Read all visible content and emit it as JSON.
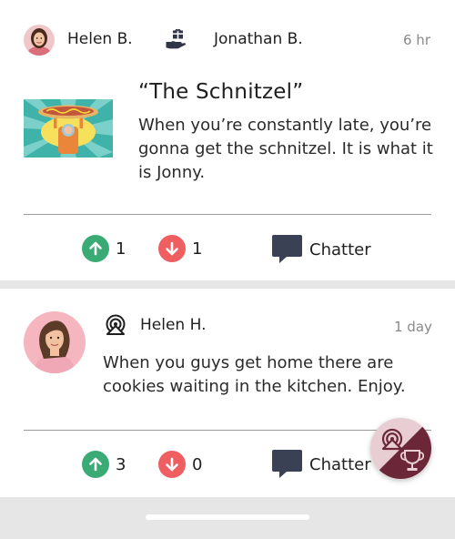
{
  "feed": [
    {
      "from": "Helen B.",
      "to": "Jonathan B.",
      "time": "6 hr",
      "title": "“The Schnitzel”",
      "body_lines": [
        "When you’re constantly late, you’re",
        "gonna get the schnitzel. It is what it",
        "is Jonny."
      ],
      "upvotes": "1",
      "downvotes": "1",
      "chatter_label": "Chatter",
      "action_icon": "gift-hand-icon"
    },
    {
      "author": "Helen H.",
      "time": "1 day",
      "body_lines": [
        "When you guys get home there are",
        "cookies waiting in the kitchen. Enjoy."
      ],
      "upvotes": "3",
      "downvotes": "0",
      "chatter_label": "Chatter",
      "type_icon": "broadcast-icon"
    }
  ],
  "fab": {
    "icons": [
      "broadcast-icon",
      "trophy-icon"
    ]
  },
  "colors": {
    "upvote": "#3bab76",
    "downvote": "#ef5f62",
    "chatter_icon": "#3a4154",
    "fab_pink": "#e8cdd3",
    "fab_maroon": "#6b2737",
    "text": "#1f1f1f",
    "muted": "#8a8a8a"
  }
}
